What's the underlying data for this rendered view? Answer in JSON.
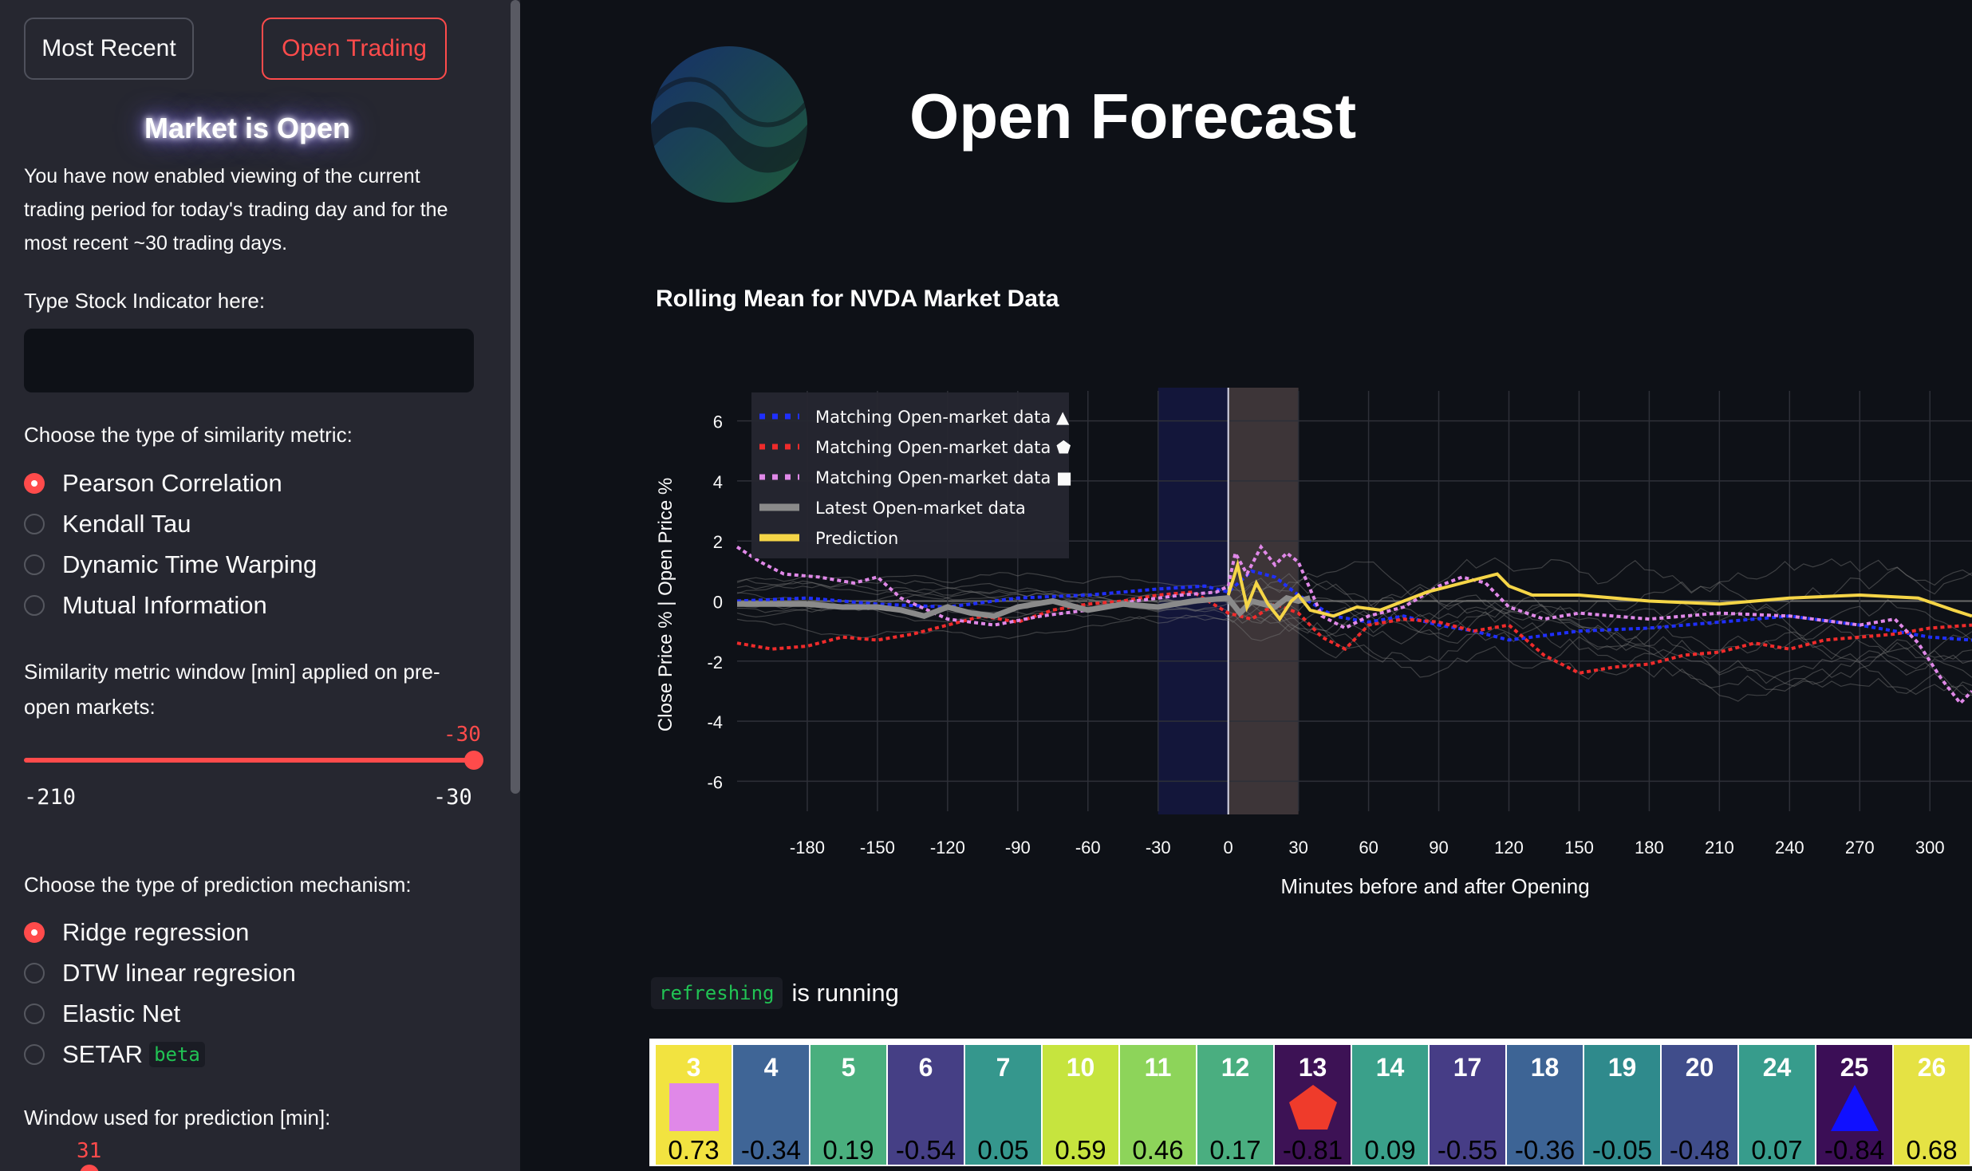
{
  "sidebar": {
    "buttons": {
      "most_recent": "Most Recent",
      "open_trading": "Open Trading"
    },
    "market_status": "Market is Open",
    "description": "You have now enabled viewing of the current trading period for today's trading day and for the most recent ~30 trading days.",
    "stock_input": {
      "label": "Type Stock Indicator here:",
      "value": ""
    },
    "similarity": {
      "label": "Choose the type of similarity metric:",
      "options": [
        "Pearson Correlation",
        "Kendall Tau",
        "Dynamic Time Warping",
        "Mutual Information"
      ],
      "selected": "Pearson Correlation"
    },
    "window_slider": {
      "label": "Similarity metric window [min] applied on pre-open markets:",
      "value": "-30",
      "min": "-210",
      "max": "-30"
    },
    "prediction": {
      "label": "Choose the type of prediction mechanism:",
      "options": [
        "Ridge regression",
        "DTW linear regresion",
        "Elastic Net",
        "SETAR"
      ],
      "beta_badge": "beta",
      "selected": "Ridge regression"
    },
    "prediction_window": {
      "label": "Window used for prediction [min]:",
      "value": "31"
    }
  },
  "main": {
    "title": "Open Forecast",
    "chart_title": "Rolling Mean for NVDA Market Data",
    "status": {
      "code": "refreshing",
      "text": "is running"
    }
  },
  "chart_data": {
    "type": "line",
    "title": "Rolling Mean for NVDA Market Data",
    "xlabel": "Minutes before and after Opening",
    "ylabel": "Close Price % | Open Price %",
    "xlim": [
      -210,
      318
    ],
    "ylim": [
      -7,
      7
    ],
    "xticks": [
      -180,
      -150,
      -120,
      -90,
      -60,
      -30,
      0,
      30,
      60,
      90,
      120,
      150,
      180,
      210,
      240,
      270,
      300
    ],
    "yticks": [
      6,
      4,
      2,
      0,
      -2,
      -4,
      -6
    ],
    "shaded_regions": [
      {
        "x": [
          -30,
          0
        ],
        "color": "#13163a"
      },
      {
        "x": [
          0,
          30
        ],
        "color": "#3d3538"
      }
    ],
    "legend_position": "top-left",
    "series": [
      {
        "name": "Matching Open-market data ▲",
        "color": "#1f2fff",
        "style": "dotted",
        "points": [
          [
            -210,
            0
          ],
          [
            -180,
            0.1
          ],
          [
            -150,
            -0.1
          ],
          [
            -120,
            -0.2
          ],
          [
            -90,
            0.1
          ],
          [
            -60,
            0.2
          ],
          [
            -30,
            0.4
          ],
          [
            -10,
            0.5
          ],
          [
            0,
            0.3
          ],
          [
            10,
            1
          ],
          [
            20,
            0.8
          ],
          [
            30,
            0.2
          ],
          [
            45,
            -0.5
          ],
          [
            60,
            -0.7
          ],
          [
            75,
            -0.5
          ],
          [
            90,
            -0.8
          ],
          [
            105,
            -1
          ],
          [
            120,
            -1.3
          ],
          [
            150,
            -1
          ],
          [
            180,
            -0.9
          ],
          [
            210,
            -0.7
          ],
          [
            240,
            -0.5
          ],
          [
            270,
            -0.8
          ],
          [
            300,
            -1.2
          ],
          [
            318,
            -1.3
          ]
        ]
      },
      {
        "name": "Matching Open-market data ⬟",
        "color": "#ef2b2b",
        "style": "dotted",
        "points": [
          [
            -210,
            -1.4
          ],
          [
            -195,
            -1.6
          ],
          [
            -180,
            -1.5
          ],
          [
            -165,
            -1.2
          ],
          [
            -150,
            -1.3
          ],
          [
            -135,
            -1.1
          ],
          [
            -120,
            -0.8
          ],
          [
            -105,
            -0.5
          ],
          [
            -90,
            -0.7
          ],
          [
            -75,
            -0.3
          ],
          [
            -60,
            -0.1
          ],
          [
            -45,
            0
          ],
          [
            -30,
            0.2
          ],
          [
            -15,
            0.3
          ],
          [
            0,
            -0.4
          ],
          [
            10,
            -0.6
          ],
          [
            20,
            -0.1
          ],
          [
            30,
            -0.4
          ],
          [
            40,
            -1.2
          ],
          [
            50,
            -1.6
          ],
          [
            60,
            -0.8
          ],
          [
            75,
            -0.6
          ],
          [
            90,
            -0.7
          ],
          [
            105,
            -1
          ],
          [
            120,
            -0.8
          ],
          [
            135,
            -1.8
          ],
          [
            150,
            -2.4
          ],
          [
            165,
            -2.2
          ],
          [
            180,
            -2.1
          ],
          [
            195,
            -1.8
          ],
          [
            210,
            -1.7
          ],
          [
            225,
            -1.4
          ],
          [
            240,
            -1.6
          ],
          [
            255,
            -1.3
          ],
          [
            270,
            -1.2
          ],
          [
            285,
            -1.1
          ],
          [
            300,
            -0.9
          ],
          [
            318,
            -0.8
          ]
        ]
      },
      {
        "name": "Matching Open-market data ■",
        "color": "#e088e8",
        "style": "dotted",
        "points": [
          [
            -210,
            1.8
          ],
          [
            -200,
            1.3
          ],
          [
            -190,
            0.9
          ],
          [
            -175,
            0.8
          ],
          [
            -160,
            0.6
          ],
          [
            -150,
            0.8
          ],
          [
            -140,
            0.1
          ],
          [
            -120,
            -0.6
          ],
          [
            -100,
            -0.8
          ],
          [
            -80,
            -0.5
          ],
          [
            -60,
            -0.3
          ],
          [
            -40,
            0
          ],
          [
            -20,
            0.2
          ],
          [
            -5,
            0.3
          ],
          [
            0,
            0.5
          ],
          [
            3,
            1.6
          ],
          [
            8,
            0.9
          ],
          [
            14,
            1.8
          ],
          [
            20,
            1.2
          ],
          [
            25,
            1.6
          ],
          [
            30,
            1.3
          ],
          [
            40,
            -0.5
          ],
          [
            50,
            -0.9
          ],
          [
            60,
            -0.5
          ],
          [
            75,
            -0.2
          ],
          [
            90,
            0.5
          ],
          [
            100,
            0.8
          ],
          [
            110,
            0.6
          ],
          [
            120,
            -0.2
          ],
          [
            135,
            -0.6
          ],
          [
            150,
            -0.4
          ],
          [
            180,
            -0.6
          ],
          [
            210,
            -0.4
          ],
          [
            240,
            -0.5
          ],
          [
            270,
            -0.8
          ],
          [
            285,
            -0.6
          ],
          [
            295,
            -1.4
          ],
          [
            305,
            -2.6
          ],
          [
            313,
            -3.4
          ],
          [
            318,
            -3
          ]
        ]
      },
      {
        "name": "Latest Open-market data",
        "color": "#8a8a8a",
        "style": "solid",
        "points": [
          [
            -210,
            -0.1
          ],
          [
            -180,
            -0.1
          ],
          [
            -165,
            -0.2
          ],
          [
            -150,
            -0.2
          ],
          [
            -140,
            -0.3
          ],
          [
            -130,
            -0.5
          ],
          [
            -120,
            -0.2
          ],
          [
            -110,
            -0.4
          ],
          [
            -100,
            -0.5
          ],
          [
            -90,
            -0.2
          ],
          [
            -75,
            0
          ],
          [
            -60,
            -0.3
          ],
          [
            -45,
            -0.1
          ],
          [
            -30,
            -0.2
          ],
          [
            -15,
            0
          ],
          [
            0,
            0.1
          ],
          [
            5,
            -0.4
          ],
          [
            10,
            0
          ],
          [
            15,
            -0.1
          ],
          [
            20,
            -0.2
          ],
          [
            25,
            0.1
          ],
          [
            30,
            0
          ],
          [
            35,
            0.1
          ]
        ]
      },
      {
        "name": "Prediction",
        "color": "#f5d547",
        "style": "solid",
        "points": [
          [
            0,
            0.2
          ],
          [
            4,
            1.2
          ],
          [
            8,
            -0.2
          ],
          [
            12,
            0.6
          ],
          [
            17,
            -0.1
          ],
          [
            22,
            -0.6
          ],
          [
            27,
            0
          ],
          [
            30,
            0.2
          ],
          [
            35,
            -0.3
          ],
          [
            45,
            -0.5
          ],
          [
            55,
            -0.2
          ],
          [
            65,
            -0.3
          ],
          [
            75,
            0
          ],
          [
            85,
            0.3
          ],
          [
            95,
            0.5
          ],
          [
            105,
            0.7
          ],
          [
            115,
            0.9
          ],
          [
            120,
            0.5
          ],
          [
            130,
            0.2
          ],
          [
            150,
            0.2
          ],
          [
            180,
            0
          ],
          [
            210,
            -0.1
          ],
          [
            240,
            0.1
          ],
          [
            270,
            0.2
          ],
          [
            295,
            0.1
          ],
          [
            310,
            -0.3
          ],
          [
            318,
            -0.5
          ]
        ]
      }
    ]
  },
  "heatmap": {
    "cells": [
      {
        "label": "3",
        "value": "0.73",
        "color": "#f2e340",
        "marker": "square"
      },
      {
        "label": "4",
        "value": "-0.34",
        "color": "#3f6596",
        "marker": ""
      },
      {
        "label": "5",
        "value": "0.19",
        "color": "#4aaf7e",
        "marker": ""
      },
      {
        "label": "6",
        "value": "-0.54",
        "color": "#453f85",
        "marker": ""
      },
      {
        "label": "7",
        "value": "0.05",
        "color": "#35978d",
        "marker": ""
      },
      {
        "label": "10",
        "value": "0.59",
        "color": "#c6e43e",
        "marker": ""
      },
      {
        "label": "11",
        "value": "0.46",
        "color": "#8dd45a",
        "marker": ""
      },
      {
        "label": "12",
        "value": "0.17",
        "color": "#4aae80",
        "marker": ""
      },
      {
        "label": "13",
        "value": "-0.81",
        "color": "#3d1255",
        "marker": "pentagon"
      },
      {
        "label": "14",
        "value": "0.09",
        "color": "#3aa08a",
        "marker": ""
      },
      {
        "label": "17",
        "value": "-0.55",
        "color": "#463d86",
        "marker": ""
      },
      {
        "label": "18",
        "value": "-0.36",
        "color": "#3d6495",
        "marker": ""
      },
      {
        "label": "19",
        "value": "-0.05",
        "color": "#2f8a8c",
        "marker": ""
      },
      {
        "label": "20",
        "value": "-0.48",
        "color": "#404d8b",
        "marker": ""
      },
      {
        "label": "24",
        "value": "0.07",
        "color": "#379c8c",
        "marker": ""
      },
      {
        "label": "25",
        "value": "-0.84",
        "color": "#3b0e56",
        "marker": "triangle"
      },
      {
        "label": "26",
        "value": "0.68",
        "color": "#e5e244",
        "marker": ""
      }
    ]
  }
}
